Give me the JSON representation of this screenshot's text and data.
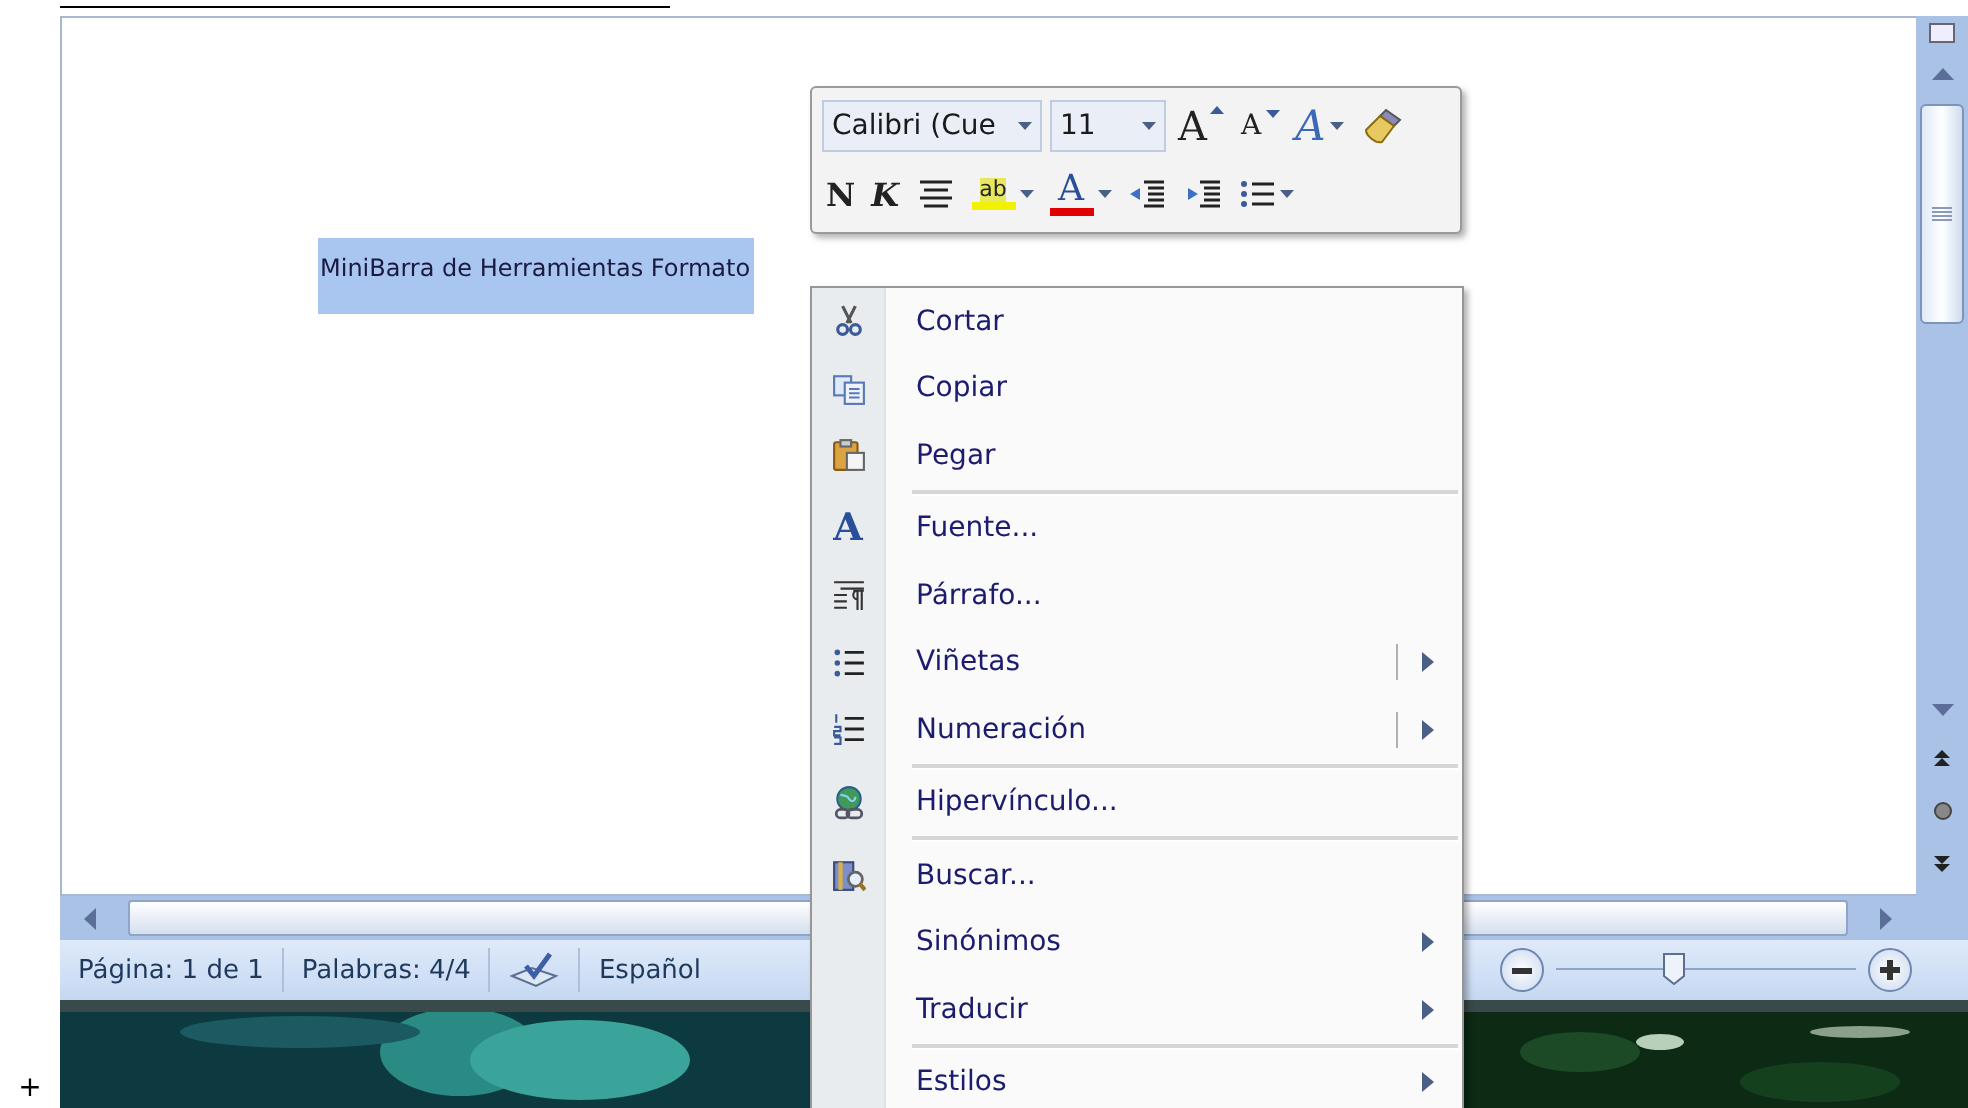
{
  "document": {
    "selected_text": "MiniBarra de Herramientas Formato"
  },
  "mini_toolbar": {
    "font": "Calibri (Cue",
    "size": "11",
    "grow_glyph": "A",
    "shrink_glyph": "A",
    "effects_glyph": "A",
    "bold": "N",
    "italic": "K",
    "highlight_glyph": "ab",
    "font_color_glyph": "A"
  },
  "context_menu": [
    {
      "kind": "item",
      "label": "Cortar",
      "submenu": false,
      "split": false
    },
    {
      "kind": "item",
      "label": "Copiar",
      "submenu": false,
      "split": false
    },
    {
      "kind": "item",
      "label": "Pegar",
      "submenu": false,
      "split": false
    },
    {
      "kind": "separator"
    },
    {
      "kind": "item",
      "label": "Fuente...",
      "submenu": false,
      "split": false,
      "glyph": "A"
    },
    {
      "kind": "item",
      "label": "Párrafo...",
      "submenu": false,
      "split": false
    },
    {
      "kind": "item",
      "label": "Viñetas",
      "submenu": true,
      "split": true
    },
    {
      "kind": "item",
      "label": "Numeración",
      "submenu": true,
      "split": true
    },
    {
      "kind": "separator"
    },
    {
      "kind": "item",
      "label": "Hipervínculo...",
      "submenu": false,
      "split": false
    },
    {
      "kind": "separator"
    },
    {
      "kind": "item",
      "label": "Buscar...",
      "submenu": false,
      "split": false
    },
    {
      "kind": "item",
      "label": "Sinónimos",
      "submenu": true,
      "split": false
    },
    {
      "kind": "item",
      "label": "Traducir",
      "submenu": true,
      "split": false
    },
    {
      "kind": "separator"
    },
    {
      "kind": "item",
      "label": "Estilos",
      "submenu": true,
      "split": false
    }
  ],
  "status_bar": {
    "page": "Página: 1 de 1",
    "words": "Palabras: 4/4",
    "language": "Español"
  },
  "zoom_slider": {
    "level": 0.39
  },
  "gutter_mark": "+"
}
